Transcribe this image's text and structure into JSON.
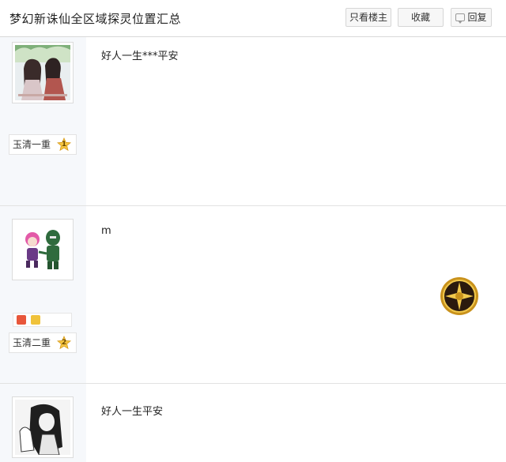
{
  "thread": {
    "title": "梦幻新诛仙全区域探灵位置汇总",
    "buttons": {
      "only_op": "只看楼主",
      "favorite": "收藏",
      "reply": "回复"
    }
  },
  "posts": [
    {
      "author": "玉清一重",
      "level": "1",
      "content": "好人一生***平安"
    },
    {
      "author": "玉清二重",
      "level": "2",
      "content": "m"
    },
    {
      "author": "",
      "level": "",
      "content": "好人一生平安"
    }
  ]
}
